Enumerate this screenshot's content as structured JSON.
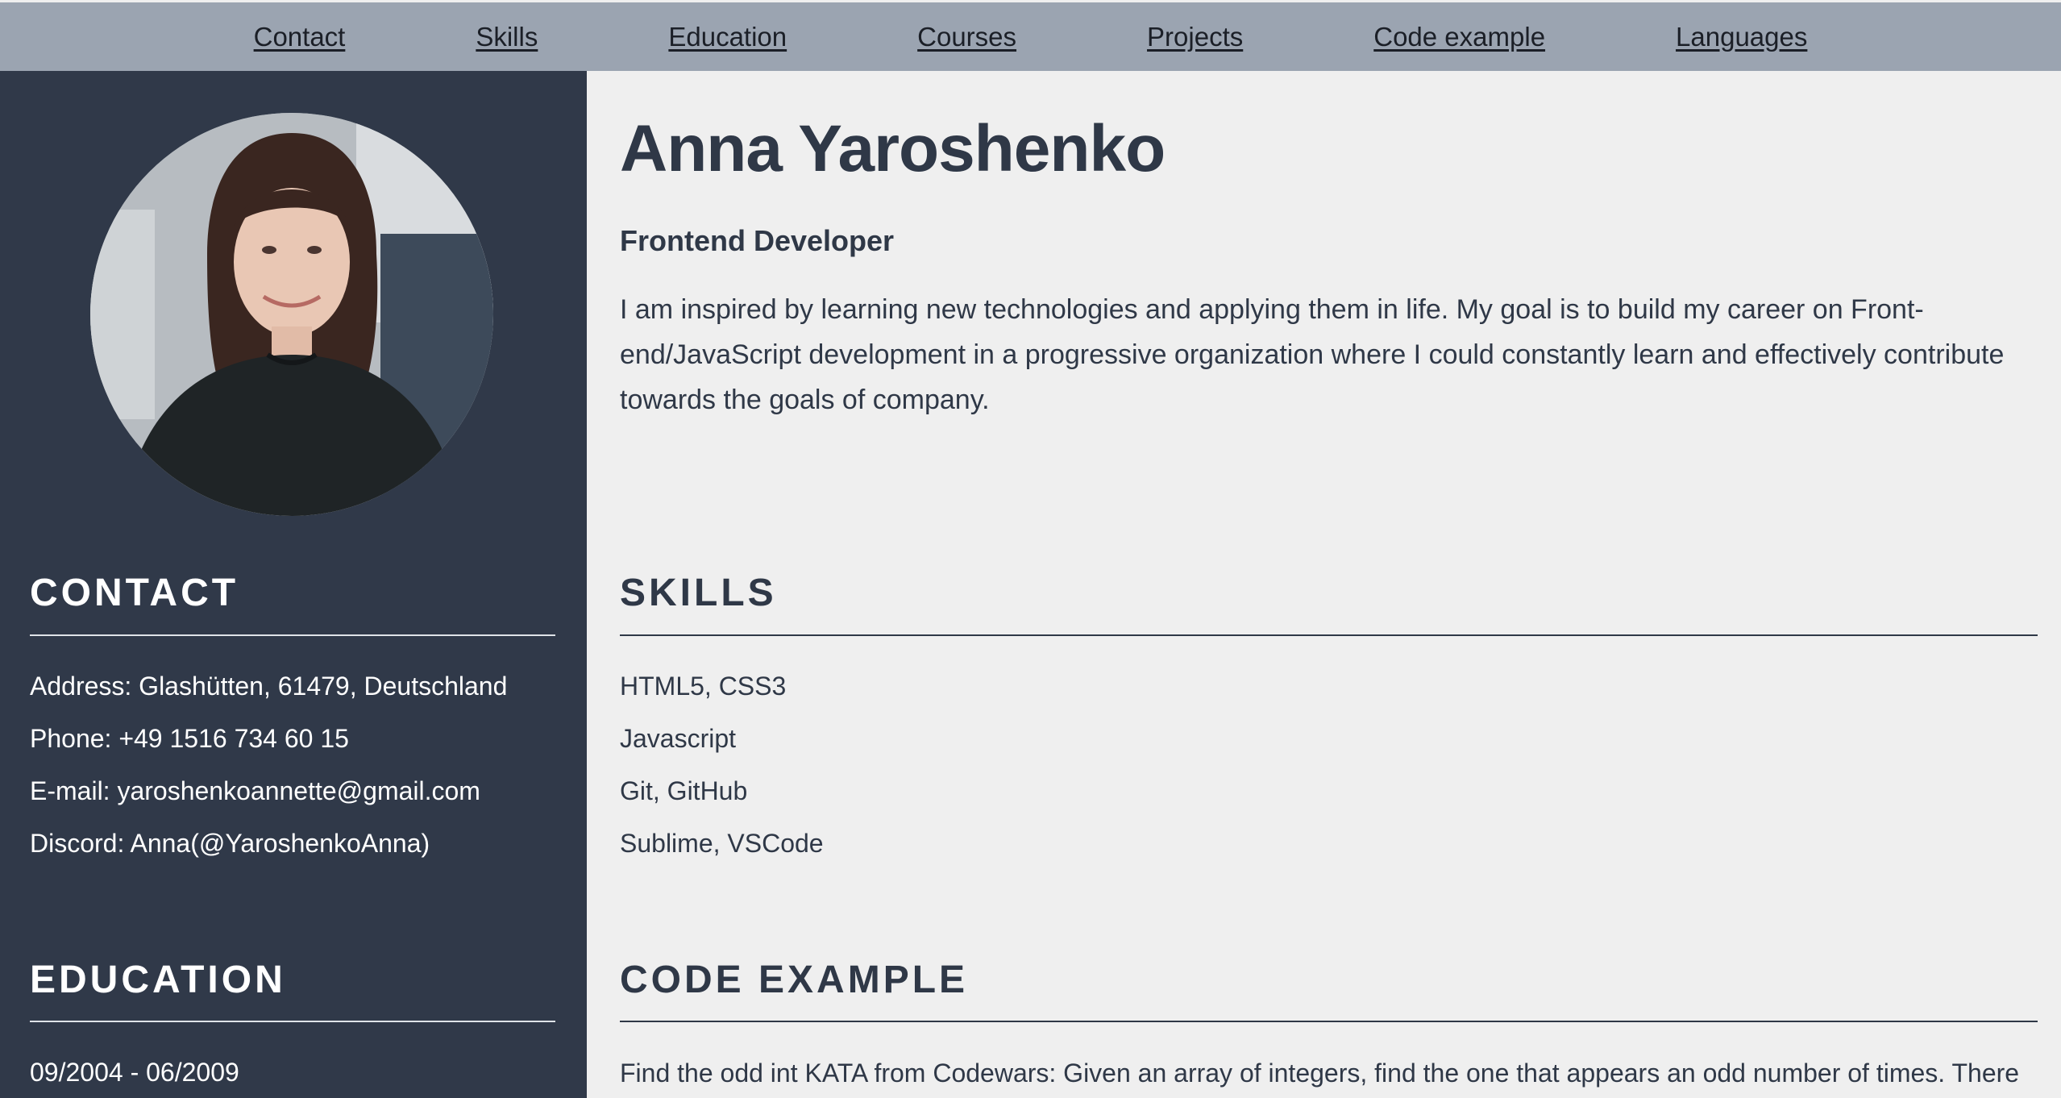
{
  "nav": {
    "items": [
      "Contact",
      "Skills",
      "Education",
      "Courses",
      "Projects",
      "Code example",
      "Languages"
    ]
  },
  "sidebar": {
    "contact": {
      "title": "CONTACT",
      "lines": [
        "Address: Glashütten, 61479, Deutschland",
        "Phone: +49 1516 734 60 15",
        "E-mail: yaroshenkoannette@gmail.com",
        "Discord: Anna(@YaroshenkoAnna)"
      ]
    },
    "education": {
      "title": "EDUCATION",
      "lines": [
        "09/2004 - 06/2009"
      ]
    }
  },
  "main": {
    "name": "Anna Yaroshenko",
    "role": "Frontend Developer",
    "about": "I am inspired by learning new technologies and applying them in life. My goal is to build my career on Front-end/JavaScript development in a progressive organization where I could constantly learn and effectively contribute towards the goals of company.",
    "skills": {
      "title": "SKILLS",
      "items": [
        "HTML5, CSS3",
        "Javascript",
        "Git, GitHub",
        "Sublime, VSCode"
      ]
    },
    "code": {
      "title": "CODE EXAMPLE",
      "description": "Find the odd int KATA from Codewars: Given an array of integers, find the one that appears an odd number of times. There"
    }
  },
  "colors": {
    "nav_bg": "#9ba4b1",
    "sidebar_bg": "#303949",
    "main_bg": "#efefef",
    "text_dark": "#2f3847"
  }
}
